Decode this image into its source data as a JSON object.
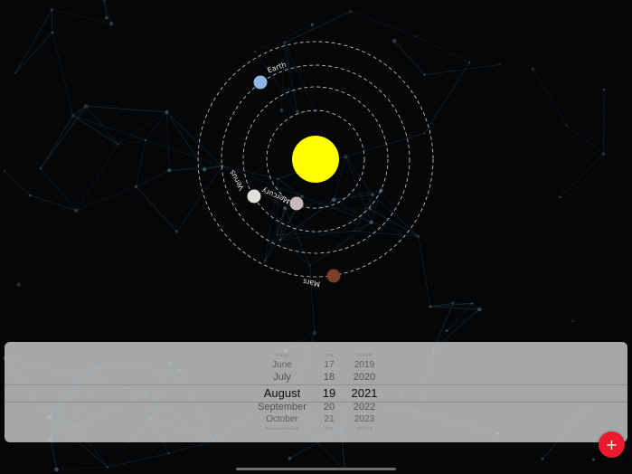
{
  "solar_system": {
    "planets": [
      {
        "name": "Mercury",
        "color": "#c9b8ba"
      },
      {
        "name": "Venus",
        "color": "#e4e1dd"
      },
      {
        "name": "Earth",
        "color": "#8eb7e8"
      },
      {
        "name": "Mars",
        "color": "#7a3e2a"
      }
    ],
    "sun_color": "#ffff00",
    "orbit_color": "#cfcfcf"
  },
  "date_picker": {
    "months": [
      "May",
      "June",
      "July",
      "August",
      "September",
      "October",
      "November"
    ],
    "days": [
      "16",
      "17",
      "18",
      "19",
      "20",
      "21",
      "22"
    ],
    "years": [
      "2018",
      "2019",
      "2020",
      "2021",
      "2022",
      "2023",
      "2024"
    ],
    "selected": {
      "month": "August",
      "day": "19",
      "year": "2021"
    }
  },
  "fab": {
    "label": "+",
    "icon": "plus-icon",
    "color": "#ea1b2d"
  }
}
